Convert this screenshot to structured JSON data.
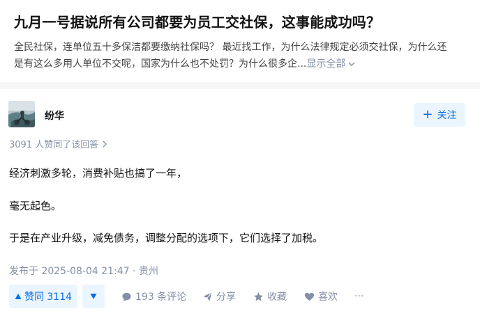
{
  "question": {
    "title": "九月一号据说所有公司都要为员工交社保，这事能成功吗？",
    "desc_line1": "全民社保，连单位五十多保洁都要缴纳社保吗？ 最近找工作，为什么法律规定必须交社保，为什么还",
    "desc_line2": "是有这么多用人单位不交呢，国家为什么也不处罚？为什么很多企...",
    "show_all": "显示全部"
  },
  "answer": {
    "author": "纷华",
    "follow_label": "关注",
    "vote_summary": "3091 人赞同了该回答",
    "paragraphs": [
      "经济刺激多轮，消费补贴也搞了一年，",
      "毫无起色。",
      "于是在产业升级，减免债务，调整分配的选项下，它们选择了加税。"
    ],
    "published": "发布于 2025-08-04 21:47 · 贵州",
    "actions": {
      "vote_up": "赞同 3114",
      "comments": "193 条评论",
      "share": "分享",
      "favorite": "收藏",
      "like": "喜欢",
      "more": "···"
    }
  },
  "colors": {
    "accent": "#056de8",
    "accent_bg": "#ebf5ff",
    "muted": "#8590a6",
    "page_bg": "#f6f6f6"
  }
}
